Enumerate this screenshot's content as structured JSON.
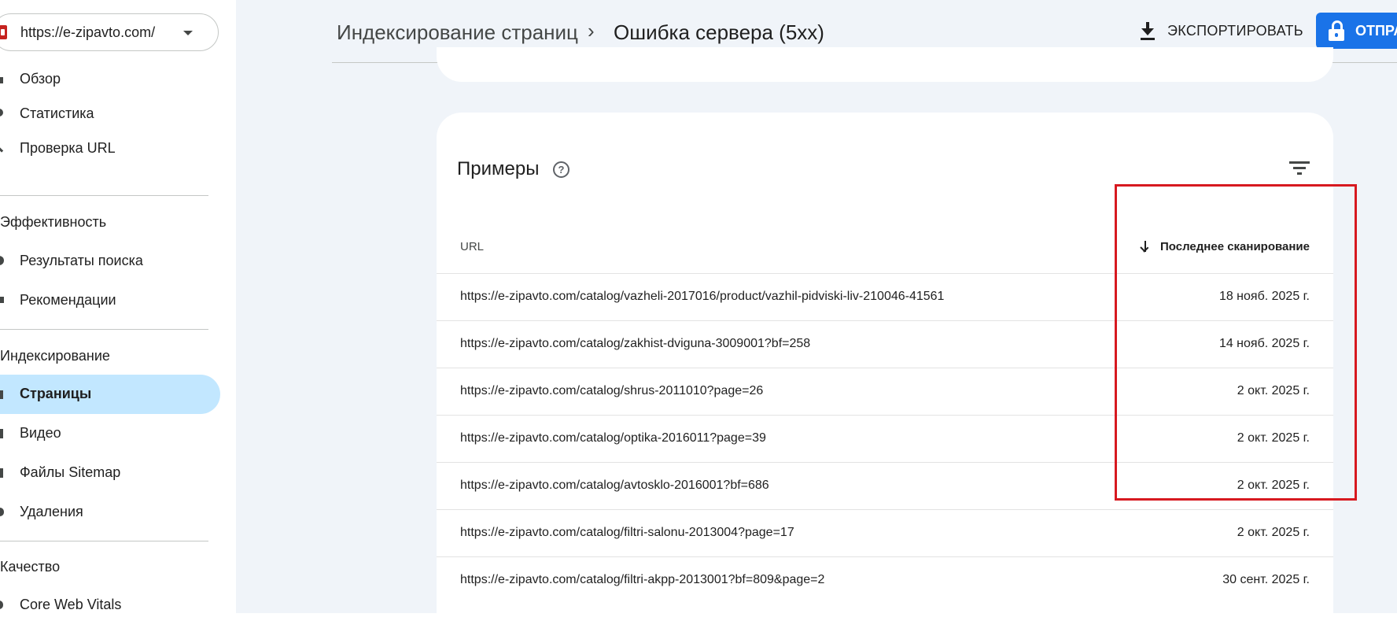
{
  "property": {
    "url": "https://e-zipavto.com/"
  },
  "sidebar": {
    "items": [
      {
        "label": "Обзор",
        "icon": "home-icon"
      },
      {
        "label": "Статистика",
        "icon": "chart-icon"
      },
      {
        "label": "Проверка URL",
        "icon": "search-icon"
      }
    ],
    "sections": [
      {
        "title": "Эффективность",
        "items": [
          {
            "label": "Результаты поиска",
            "icon": "google-icon"
          },
          {
            "label": "Рекомендации",
            "icon": "sparkle-icon"
          }
        ]
      },
      {
        "title": "Индексирование",
        "items": [
          {
            "label": "Страницы",
            "icon": "pages-icon",
            "active": true
          },
          {
            "label": "Видео",
            "icon": "video-icon"
          },
          {
            "label": "Файлы Sitemap",
            "icon": "sitemap-icon"
          },
          {
            "label": "Удаления",
            "icon": "removals-icon"
          }
        ]
      },
      {
        "title": "Качество",
        "items": [
          {
            "label": "Core Web Vitals",
            "icon": "speed-icon"
          }
        ]
      }
    ]
  },
  "header": {
    "breadcrumb_parent": "Индексирование страниц",
    "breadcrumb_separator": "›",
    "breadcrumb_current": "Ошибка сервера (5xx)",
    "export_label": "ЭКСПОРТИРОВАТЬ",
    "submit_label": "ОТПРА"
  },
  "examples": {
    "title": "Примеры",
    "help": "?",
    "columns": {
      "url": "URL",
      "last_crawl": "Последнее сканирование"
    },
    "rows": [
      {
        "url": "https://e-zipavto.com/catalog/vazheli-2017016/product/vazhil-pidviski-liv-210046-41561",
        "date": "18 нояб. 2025 г."
      },
      {
        "url": "https://e-zipavto.com/catalog/zakhist-dviguna-3009001?bf=258",
        "date": "14 нояб. 2025 г."
      },
      {
        "url": "https://e-zipavto.com/catalog/shrus-2011010?page=26",
        "date": "2 окт. 2025 г."
      },
      {
        "url": "https://e-zipavto.com/catalog/optika-2016011?page=39",
        "date": "2 окт. 2025 г."
      },
      {
        "url": "https://e-zipavto.com/catalog/avtosklo-2016001?bf=686",
        "date": "2 окт. 2025 г."
      },
      {
        "url": "https://e-zipavto.com/catalog/filtri-salonu-2013004?page=17",
        "date": "2 окт. 2025 г."
      },
      {
        "url": "https://e-zipavto.com/catalog/filtri-akpp-2013001?bf=809&page=2",
        "date": "30 сент. 2025 г."
      }
    ]
  },
  "colors": {
    "accent": "#1a73e8",
    "active_nav": "#c2e7ff",
    "highlight": "#d71920"
  }
}
